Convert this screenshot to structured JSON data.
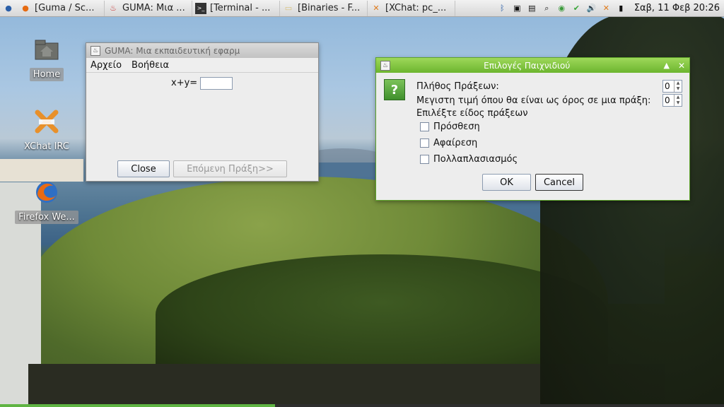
{
  "panel": {
    "tasks": [
      {
        "label": "[Guma / Sc...",
        "icon": "firefox-icon"
      },
      {
        "label": "GUMA: Μια ...",
        "icon": "java-icon"
      },
      {
        "label": "[Terminal - ...",
        "icon": "terminal-icon"
      },
      {
        "label": "[Binaries - F...",
        "icon": "folder-icon"
      },
      {
        "label": "[XChat: pc_...",
        "icon": "xchat-icon"
      }
    ],
    "clock": "Σαβ, 11 Φεβ  20:26"
  },
  "desktop": {
    "icons": [
      {
        "label": "Home",
        "icon": "home-folder-icon"
      },
      {
        "label": "XChat IRC",
        "icon": "xchat-icon"
      },
      {
        "label": "Firefox We...",
        "icon": "firefox-icon"
      }
    ]
  },
  "guma_window": {
    "title": "GUMA: Μια  εκπαιδευτική εφαρμ",
    "menu": [
      "Αρχείο",
      "Βοήθεια"
    ],
    "expression_label": "x+y=",
    "answer_value": "",
    "close_label": "Close",
    "next_label": "Επόμενη Πράξη>>"
  },
  "options_dialog": {
    "title": "Επιλογές Παιχνιδιού",
    "count_label": "Πλήθος Πράξεων:",
    "count_value": "0",
    "max_label": "Μεγιστη τιμή όπου θα είναι ως όρος σε μια πράξη:",
    "max_value": "0",
    "ops_label": "Επιλέξτε είδος πράξεων",
    "ops": [
      "Πρόσθεση",
      "Αφαίρεση",
      "Πολλαπλασιασμός"
    ],
    "ok_label": "OK",
    "cancel_label": "Cancel"
  }
}
